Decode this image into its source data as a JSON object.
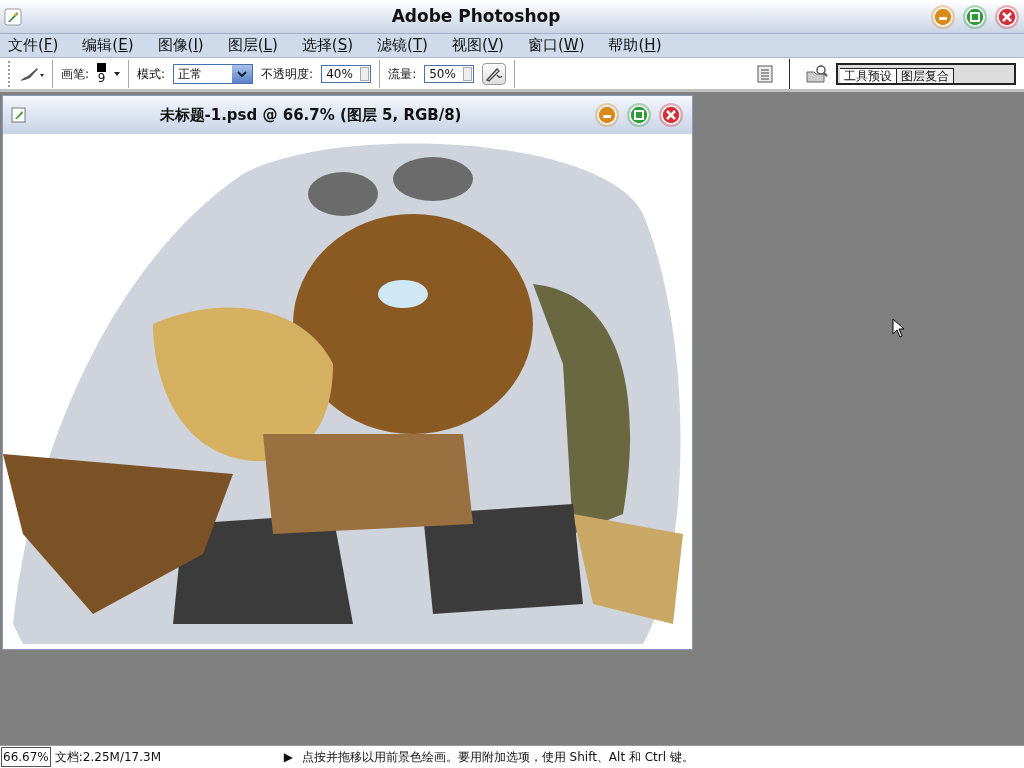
{
  "window": {
    "title": "Adobe Photoshop"
  },
  "menu": [
    {
      "before": "文件(",
      "key": "F",
      "after": ")"
    },
    {
      "before": "编辑(",
      "key": "E",
      "after": ")"
    },
    {
      "before": "图像(",
      "key": "I",
      "after": ")"
    },
    {
      "before": "图层(",
      "key": "L",
      "after": ")"
    },
    {
      "before": "选择(",
      "key": "S",
      "after": ")"
    },
    {
      "before": "滤镜(",
      "key": "T",
      "after": ")"
    },
    {
      "before": "视图(",
      "key": "V",
      "after": ")"
    },
    {
      "before": "窗口(",
      "key": "W",
      "after": ")"
    },
    {
      "before": "帮助(",
      "key": "H",
      "after": ")"
    }
  ],
  "options": {
    "brush_label": "画笔:",
    "brush_size": "9",
    "mode_label": "模式:",
    "mode_value": "正常",
    "opacity_label": "不透明度:",
    "opacity_value": "40%",
    "flow_label": "流量:",
    "flow_value": "50%"
  },
  "palette_tabs": [
    {
      "label": "工具预设",
      "selected": true
    },
    {
      "label": "图层复合",
      "selected": false
    }
  ],
  "document": {
    "title": "未标题-1.psd @ 66.7% (图层 5, RGB/8)"
  },
  "status_bar": {
    "zoom": "66.67%",
    "doc_info": "文档:2.25M/17.3M",
    "hint_arrow": "▶",
    "hint": "点按并拖移以用前景色绘画。要用附加选项，使用 Shift、Alt 和 Ctrl 键。"
  }
}
